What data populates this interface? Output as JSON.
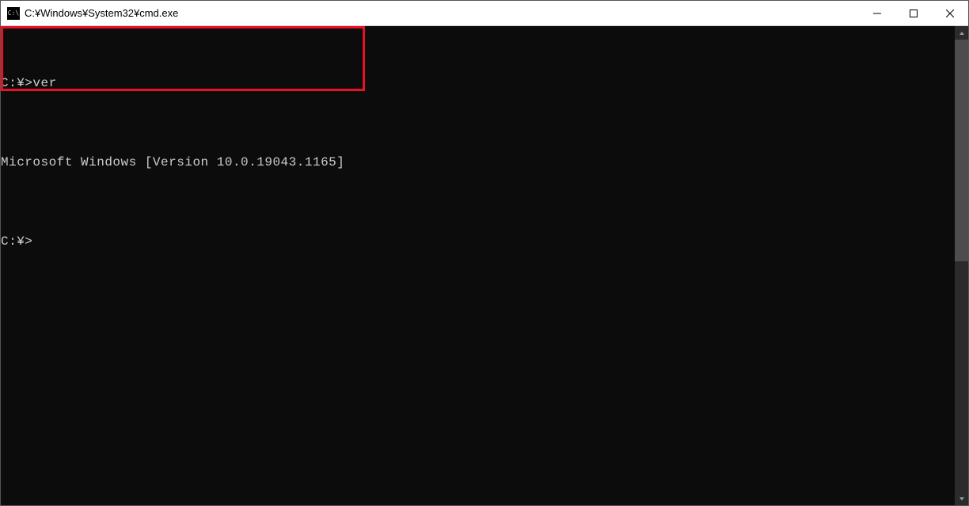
{
  "titlebar": {
    "icon_text": "C:\\",
    "title": "C:¥Windows¥System32¥cmd.exe"
  },
  "terminal": {
    "line1": "C:¥>ver",
    "line2": "",
    "line3": "Microsoft Windows [Version 10.0.19043.1165]",
    "line4": "",
    "line5": "C:¥>"
  }
}
